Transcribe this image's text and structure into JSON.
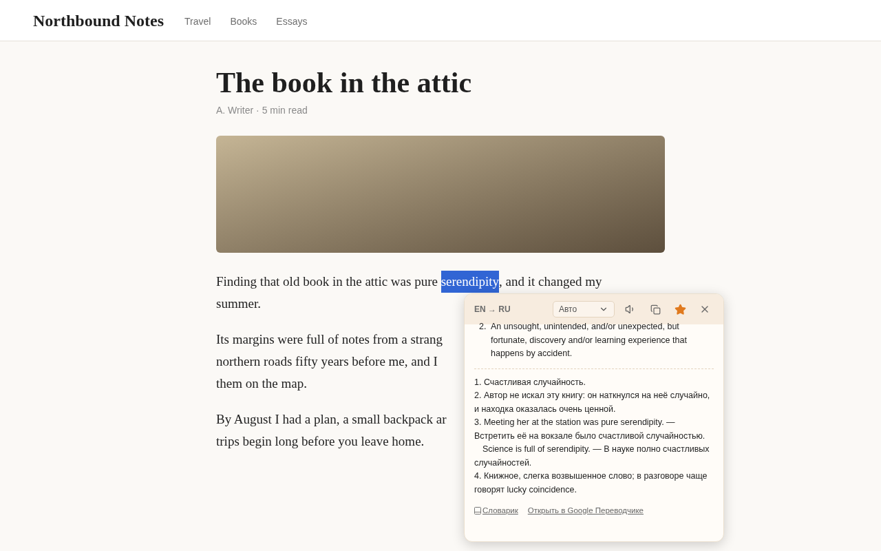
{
  "site": {
    "title": "Northbound Notes",
    "nav": [
      "Travel",
      "Books",
      "Essays"
    ]
  },
  "article": {
    "title": "The book in the attic",
    "meta": "A. Writer · 5 min read",
    "paragraphs": [
      {
        "lines": [
          [
            {
              "text": "Finding that old book in the attic was pure "
            },
            {
              "text": "serendipity",
              "selected": true
            },
            {
              "text": ", and it changed my"
            }
          ],
          [
            {
              "text": "summer."
            }
          ]
        ]
      },
      {
        "lines": [
          [
            {
              "text": "Its margins were full of notes from a strang"
            }
          ],
          [
            {
              "text": "northern roads fifty years before me, and I"
            }
          ],
          [
            {
              "text": "them on the map."
            }
          ]
        ]
      },
      {
        "lines": [
          [
            {
              "text": "By August I had a plan, a small backpack ar"
            }
          ],
          [
            {
              "text": "trips begin long before you leave home."
            }
          ]
        ]
      }
    ]
  },
  "popup": {
    "direction": "EN → RU",
    "mode": {
      "value": "Авто"
    },
    "favorite": true,
    "definition": {
      "number": "2.",
      "text": "An unsought, unintended, and/or unexpected, but fortunate, discovery and/or learning experience that happens by accident."
    },
    "translation": [
      {
        "kind": "line",
        "text": "1. Счастливая случайность."
      },
      {
        "kind": "line",
        "text": "2. Автор не искал эту книгу: он наткнулся на неё случайно, и находка оказалась очень ценной."
      },
      {
        "kind": "line",
        "text": "3. Meeting her at the station was pure serendipity. — Встретить её на вокзале было счастливой случайностью."
      },
      {
        "kind": "indented",
        "text": "Science is full of serendipity. — В науке полно счастливых случайностей."
      },
      {
        "kind": "line",
        "text": "4. Книжное, слегка возвышенное слово; в разговоре чаще говорят lucky coincidence."
      }
    ],
    "links": [
      "Словарик",
      "Открыть в Google Переводчике"
    ]
  }
}
